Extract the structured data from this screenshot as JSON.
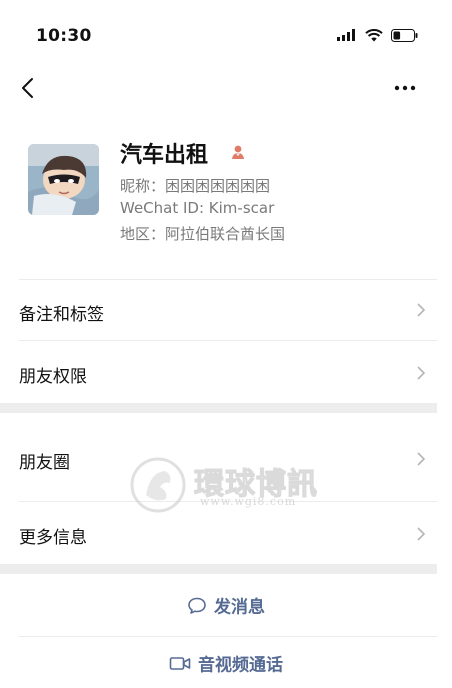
{
  "status_bar": {
    "time": "10:30",
    "battery_level": 0.35
  },
  "profile": {
    "display_name": "汽车出租",
    "nickname": "昵称：困困困困困困困",
    "wechat_id": "WeChat ID: Kim-scar",
    "region": "地区：阿拉伯联合酋长国",
    "gender_icon": "female-icon",
    "gender_color": "#e07b6a"
  },
  "menu": {
    "notes_tags": "备注和标签",
    "friend_permissions": "朋友权限",
    "moments": "朋友圈",
    "more_info": "更多信息"
  },
  "actions": {
    "send_message": "发消息",
    "voice_video_call": "音视频通话"
  },
  "watermark": {
    "title": "環球博訊",
    "url": "www.wgi8.com"
  },
  "colors": {
    "link_blue": "#566b94",
    "divider": "#ececec",
    "gap": "#ededed"
  }
}
